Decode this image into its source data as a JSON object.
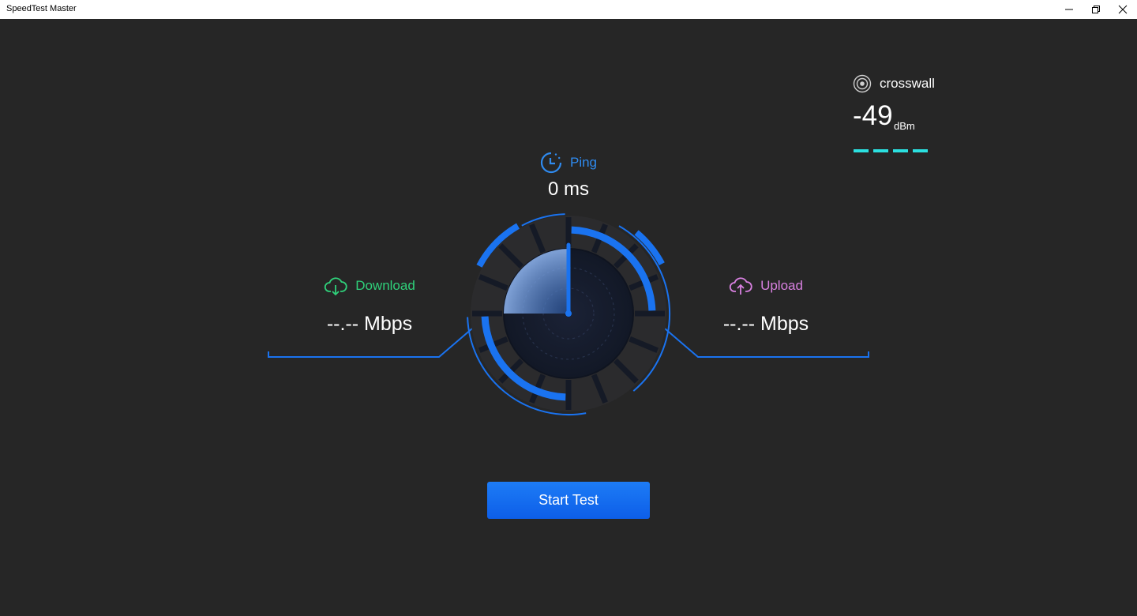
{
  "window": {
    "title": "SpeedTest Master"
  },
  "network": {
    "ssid": "crosswall",
    "signal_value": "-49",
    "signal_unit": "dBm",
    "signal_bars": 4
  },
  "ping": {
    "label": "Ping",
    "value": "0 ms"
  },
  "download": {
    "label": "Download",
    "value": "--.-- Mbps"
  },
  "upload": {
    "label": "Upload",
    "value": "--.-- Mbps"
  },
  "actions": {
    "start_label": "Start Test"
  },
  "colors": {
    "accent": "#1a73f0",
    "download": "#2fd07a",
    "upload": "#d880e0",
    "signal": "#2be0e0",
    "background": "#262626"
  }
}
